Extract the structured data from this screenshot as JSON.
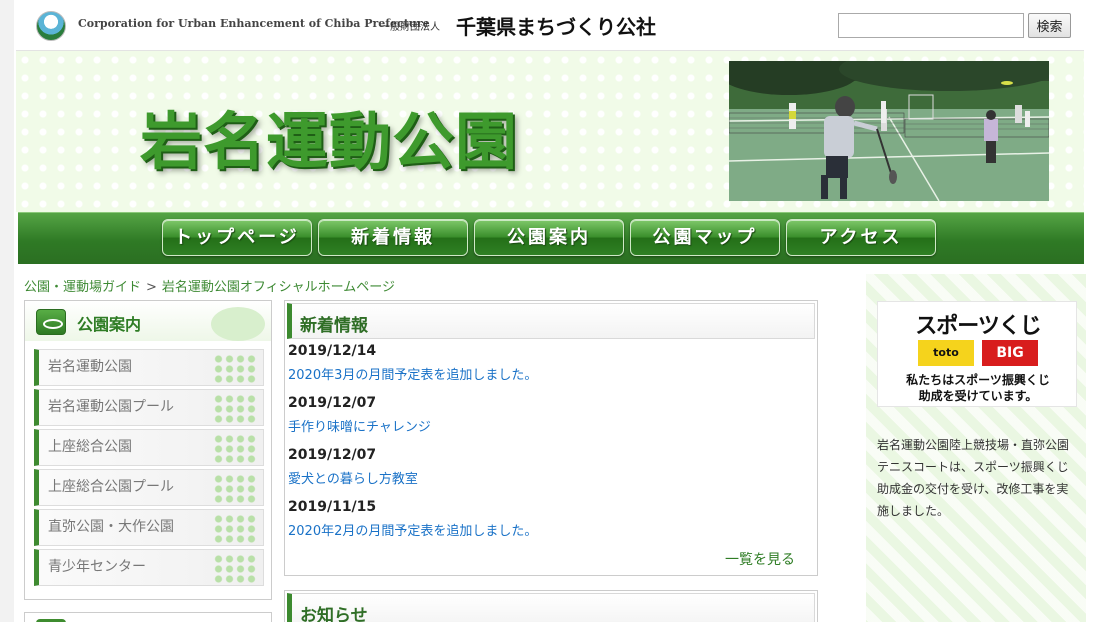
{
  "header": {
    "org_en": "Corporation for Urban Enhancement of Chiba Prefecture",
    "org_type": "一般財団法人",
    "org_jp": "千葉県まちづくり公社",
    "search_placeholder": "",
    "search_button": "検索"
  },
  "banner": {
    "title": "岩名運動公園"
  },
  "nav": {
    "items": [
      {
        "label": "トップページ"
      },
      {
        "label": "新着情報"
      },
      {
        "label": "公園案内"
      },
      {
        "label": "公園マップ"
      },
      {
        "label": "アクセス"
      }
    ]
  },
  "breadcrumb": {
    "parent": "公園・運動場ガイド",
    "separator": ">",
    "current": "岩名運動公園オフィシャルホームページ"
  },
  "sidebar": {
    "title": "公園案内",
    "items": [
      {
        "label": "岩名運動公園"
      },
      {
        "label": "岩名運動公園プール"
      },
      {
        "label": "上座総合公園"
      },
      {
        "label": "上座総合公園プール"
      },
      {
        "label": "直弥公園・大作公園"
      },
      {
        "label": "青少年センター"
      }
    ]
  },
  "news": {
    "title": "新着情報",
    "items": [
      {
        "date": "2019/12/14",
        "text": "2020年3月の月間予定表を追加しました。"
      },
      {
        "date": "2019/12/07",
        "text": "手作り味噌にチャレンジ"
      },
      {
        "date": "2019/12/07",
        "text": "愛犬との暮らし方教室"
      },
      {
        "date": "2019/11/15",
        "text": "2020年2月の月間予定表を追加しました。"
      }
    ],
    "more": "一覧を見る"
  },
  "notice": {
    "title": "お知らせ"
  },
  "right": {
    "toto_title": "スポーツくじ",
    "toto_logo": "toto",
    "big_logo": "BIG",
    "toto_caption_1": "私たちはスポーツ振興くじ",
    "toto_caption_2": "助成を受けています。",
    "info": "岩名運動公園陸上競技場・直弥公園テニスコートは、スポーツ振興くじ助成金の交付を受け、改修工事を実施しました。"
  },
  "colors": {
    "brand_green": "#3e9a2d",
    "link_blue": "#1a72c7",
    "banner_bg": "#f1fbe8"
  }
}
